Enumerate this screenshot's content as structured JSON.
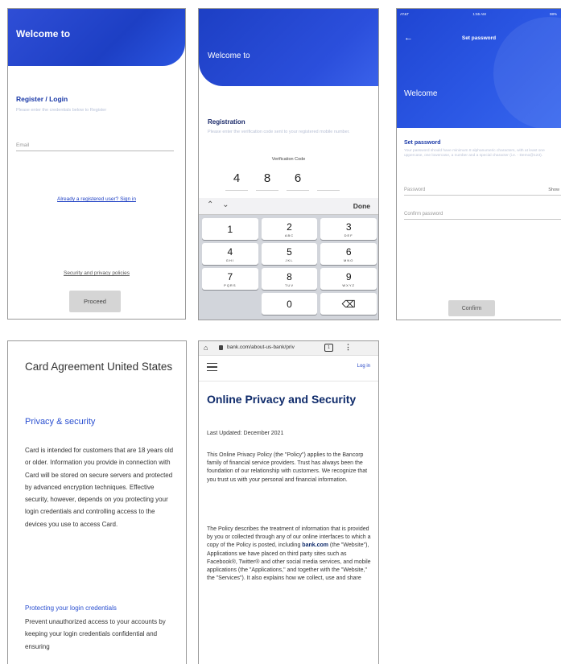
{
  "screen1": {
    "hero_title": "Welcome to",
    "register_title": "Register / Login",
    "register_hint": "Please enter the credentials below to Register",
    "email_placeholder": "Email",
    "signin_link": "Already a registered user? Sign in",
    "policy_link": "Security and privacy policies",
    "proceed_label": "Proceed",
    "accent": "#1d3fc4"
  },
  "screen2": {
    "hero_title": "Welcome to",
    "registration_title": "Registration",
    "registration_hint": "Please enter the verification code sent to your registered mobile number.",
    "verification_label": "Verification Code",
    "digits": [
      "4",
      "8",
      "6",
      ""
    ],
    "keyboard_done": "Done",
    "keyboard_arrows": "^ v",
    "keys": [
      {
        "num": "1",
        "letters": ""
      },
      {
        "num": "2",
        "letters": "ABC"
      },
      {
        "num": "3",
        "letters": "DEF"
      },
      {
        "num": "4",
        "letters": "GHI"
      },
      {
        "num": "5",
        "letters": "JKL"
      },
      {
        "num": "6",
        "letters": "MNO"
      },
      {
        "num": "7",
        "letters": "PQRS"
      },
      {
        "num": "8",
        "letters": "TUV"
      },
      {
        "num": "9",
        "letters": "WXYZ"
      },
      {
        "num": "",
        "letters": ""
      },
      {
        "num": "0",
        "letters": ""
      },
      {
        "num": "⌫",
        "letters": ""
      }
    ]
  },
  "screen3": {
    "status_carrier": "AT&T",
    "status_time": "1:55 AM",
    "status_battery": "98%",
    "back_icon": "back-arrow-icon",
    "top_title": "Set password",
    "welcome": "Welcome",
    "set_password_title": "Set password",
    "set_password_hint": "Your password should have minimum 8 alphanumeric characters, with at least one uppercase, one lowercase, a number and a special character (i.e. - Demo@123).",
    "password_placeholder": "Password",
    "show_label": "Show",
    "confirm_placeholder": "Confirm password",
    "confirm_label": "Confirm"
  },
  "screen4": {
    "title": "Card Agreement United States",
    "section_title": "Privacy & security",
    "body": "Card is intended for customers that are 18 years old or older. Information you provide in connection with Card will be stored on secure servers and protected by advanced encryption techniques. Effective security, however, depends on you protecting your login credentials and controlling access to the devices you use to access Card.",
    "subsection_title": "Protecting your login credentials",
    "body2": "Prevent unauthorized access to your accounts by keeping your login credentials confidential and ensuring"
  },
  "screen5": {
    "url": "bank.com/about-us-bank/priv",
    "tab_count": "1",
    "login_label": "Log in",
    "title": "Online Privacy and Security",
    "updated": "Last Updated: December 2021",
    "para1": "This Online Privacy Policy (the \"Policy\") applies to the Bancorp family of financial service providers. Trust has always been the foundation of our relationship with customers. We recognize that you trust us with your personal and financial information.",
    "para2_a": "The Policy describes the treatment of information that is provided by you or collected through any of our online interfaces to which a copy of the Policy is posted, including ",
    "para2_link": "bank.com",
    "para2_b": " (the \"Website\"), Applications we have placed on third party sites such as Facebook®, Twitter® and other social media services, and mobile applications (the \"Applications,\" and together with the \"Website,\" the \"Services\"). It also explains how we collect, use and share"
  }
}
